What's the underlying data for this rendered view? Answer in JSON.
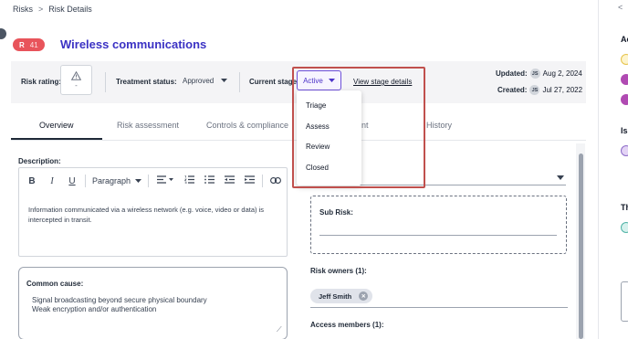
{
  "breadcrumb": {
    "root": "Risks",
    "separator": ">",
    "current": "Risk Details"
  },
  "risk": {
    "badge_letter": "R",
    "badge_number": "41",
    "title": "Wireless communications",
    "badge_color": "#e8545b"
  },
  "status": {
    "risk_rating_label": "Risk rating:",
    "risk_rating_value": "-",
    "treatment_label": "Treatment status:",
    "treatment_value": "Approved",
    "stage_label": "Current stage:",
    "stage_value": "Active",
    "stage_details_link": "View stage details",
    "updated_label": "Updated:",
    "updated_initials": "JS",
    "updated_date": "Aug 2, 2024",
    "created_label": "Created:",
    "created_initials": "JS",
    "created_date": "Jul 27, 2022"
  },
  "stage_menu": {
    "items": [
      "Triage",
      "Assess",
      "Review",
      "Closed"
    ]
  },
  "tabs": [
    {
      "label": "Overview"
    },
    {
      "label": "Risk assessment"
    },
    {
      "label": "Controls & compliance"
    },
    {
      "label": "nt"
    },
    {
      "label": "History"
    }
  ],
  "description": {
    "label": "Description:",
    "toolbar_paragraph": "Paragraph",
    "text": "Information communicated via a wireless network (e.g. voice, video or data) is intercepted in transit."
  },
  "common_cause": {
    "label": "Common cause:",
    "lines": [
      "Signal broadcasting beyond secure physical boundary",
      "Weak encryption and/or authentication"
    ]
  },
  "right": {
    "sub_risk_label": "Sub Risk:",
    "owners_label": "Risk owners (1):",
    "owner_chip": "Jeff Smith",
    "access_label": "Access members (1):"
  },
  "side_panel": {
    "labels": [
      "Ac",
      "Iss",
      "Th"
    ],
    "dot_colors": [
      "#f5d76e",
      "#b04ab2",
      "#b04ab2",
      "#c9a8e8",
      "#4fb3a6"
    ]
  },
  "colors": {
    "accent": "#3b32c4",
    "highlight": "#c0504d",
    "stage": "#4c33c8"
  }
}
